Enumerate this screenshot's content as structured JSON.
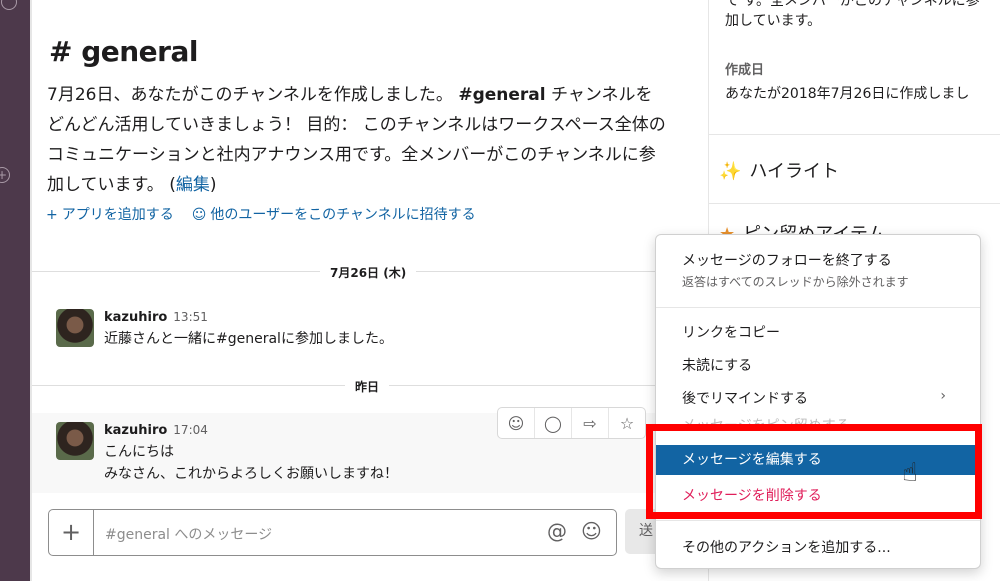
{
  "channel": {
    "title": "# general",
    "intro_part1": "7月26日、あなたがこのチャンネルを作成しました。",
    "intro_channel": "#general",
    "intro_part2": " チャンネルをどんどん活用していきましょう！ 目的： このチャンネルはワークスペース全体のコミュニケーションと社内アナウンス用です。全メンバーがこのチャンネルに参加しています。 (",
    "intro_edit": "編集",
    "intro_close": ")",
    "add_app": "アプリを追加する",
    "invite_users": "他のユーザーをこのチャンネルに招待する"
  },
  "dividers": [
    {
      "label": "7月26日 (木)"
    },
    {
      "label": "昨日"
    }
  ],
  "messages": [
    {
      "user": "kazuhiro",
      "time": "13:51",
      "lines": [
        "近藤さんと一緒に#generalに参加しました。"
      ]
    },
    {
      "user": "kazuhiro",
      "time": "17:04",
      "lines": [
        "こんにちは",
        "みなさん、これからよろしくお願いしますね！"
      ]
    }
  ],
  "composer": {
    "placeholder": "#general へのメッセージ",
    "send_label": "送"
  },
  "right_panel": {
    "top_text_partial": "て す。全メンバーがこのチャンネルに参",
    "top_text_line2": "加しています。",
    "created_label": "作成日",
    "created_value": "あなたが2018年7月26日に作成しまし",
    "highlights": "ハイライト",
    "pinned_partial": "ピン留めアイテム"
  },
  "context_menu": {
    "items": [
      {
        "label": "メッセージのフォローを終了する",
        "sub": "返答はすべてのスレッドから除外されます"
      },
      {
        "label": "リンクをコピー"
      },
      {
        "label": "未読にする"
      },
      {
        "label": "後でリマインドする",
        "chevron": "›"
      },
      {
        "label": "メッセージをピン留めする"
      },
      {
        "label": "メッセージを編集する"
      },
      {
        "label": "メッセージを削除する"
      },
      {
        "label": "その他のアクションを追加する..."
      }
    ]
  },
  "colors": {
    "accent": "#1264a3",
    "danger": "#e01e5a",
    "highlight_frame": "#ff0000",
    "sidebar": "#4d394b"
  }
}
